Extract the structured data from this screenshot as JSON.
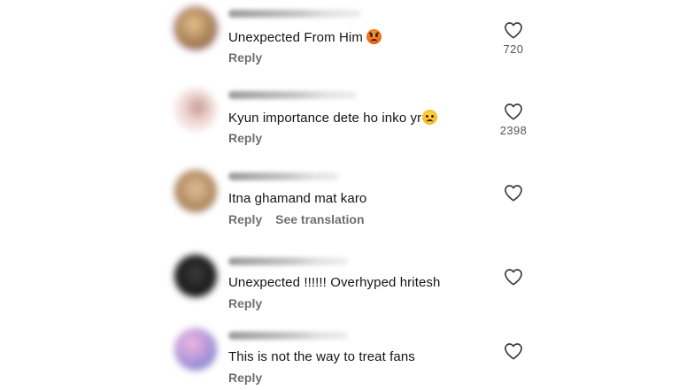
{
  "comments": [
    {
      "text": "Unexpected From Him",
      "emoji": "angry-face-icon",
      "actions": [
        "Reply"
      ],
      "likes": "720",
      "avatar_colors": [
        "#d9b07a",
        "#7a5a3a"
      ]
    },
    {
      "text": "Kyun importance dete ho inko yr",
      "emoji": "sad-face-icon",
      "actions": [
        "Reply"
      ],
      "likes": "2398",
      "avatar_colors": [
        "#f3d9d6",
        "#b98a86"
      ]
    },
    {
      "text": "Itna ghamand mat karo",
      "emoji": "",
      "actions": [
        "Reply",
        "See translation"
      ],
      "likes": "",
      "avatar_colors": [
        "#d7b389",
        "#8c6a48"
      ]
    },
    {
      "text": "Unexpected !!!!!! Overhyped hritesh",
      "emoji": "",
      "actions": [
        "Reply"
      ],
      "likes": "",
      "avatar_colors": [
        "#2e2e2e",
        "#0c0c0c"
      ]
    },
    {
      "text": "This is not the way to treat fans",
      "emoji": "",
      "actions": [
        "Reply"
      ],
      "likes": "",
      "avatar_colors": [
        "#e9a8e0",
        "#5a7fd0"
      ]
    }
  ]
}
